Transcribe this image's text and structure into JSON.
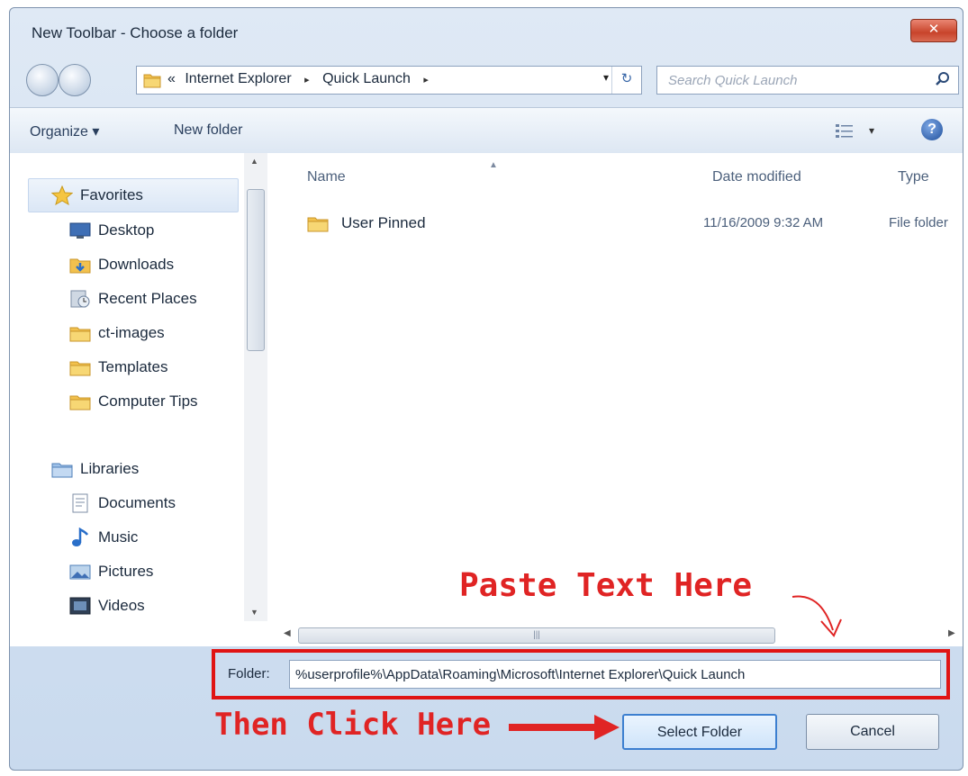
{
  "window": {
    "title": "New Toolbar - Choose a folder",
    "close_label": "✕"
  },
  "address": {
    "prefix": "«",
    "segments": [
      "Internet Explorer",
      "Quick Launch"
    ],
    "separator": "▸",
    "dropdown": "▾",
    "refresh": "↻"
  },
  "search": {
    "placeholder": "Search Quick Launch"
  },
  "toolbar": {
    "organize_label": "Organize ▾",
    "new_folder_label": "New folder",
    "views_dropdown": "▾",
    "help_label": "?"
  },
  "nav": {
    "favorites": [
      {
        "label": "Favorites",
        "icon": "star-icon"
      },
      {
        "label": "Desktop",
        "icon": "desktop-icon"
      },
      {
        "label": "Downloads",
        "icon": "downloads-icon"
      },
      {
        "label": "Recent Places",
        "icon": "recent-places-icon"
      },
      {
        "label": "ct-images",
        "icon": "folder-icon"
      },
      {
        "label": "Templates",
        "icon": "folder-icon"
      },
      {
        "label": "Computer Tips",
        "icon": "folder-icon"
      }
    ],
    "libraries": [
      {
        "label": "Libraries",
        "icon": "libraries-icon"
      },
      {
        "label": "Documents",
        "icon": "documents-icon"
      },
      {
        "label": "Music",
        "icon": "music-icon"
      },
      {
        "label": "Pictures",
        "icon": "pictures-icon"
      },
      {
        "label": "Videos",
        "icon": "videos-icon"
      }
    ]
  },
  "files": {
    "columns": [
      "Name",
      "Date modified",
      "Type"
    ],
    "rows": [
      {
        "name": "User Pinned",
        "date": "11/16/2009 9:32 AM",
        "type": "File folder"
      }
    ]
  },
  "footer": {
    "folder_label": "Folder:",
    "folder_value": "%userprofile%\\AppData\\Roaming\\Microsoft\\Internet Explorer\\Quick Launch",
    "select_button": "Select Folder",
    "cancel_button": "Cancel"
  },
  "annotations": {
    "paste": "Paste Text Here",
    "then": "Then Click Here"
  },
  "colors": {
    "annotation_red": "#e02424",
    "frame_red": "#e01414",
    "title_text": "#1b2a3d",
    "folder_yellow": "#f2c14e"
  }
}
